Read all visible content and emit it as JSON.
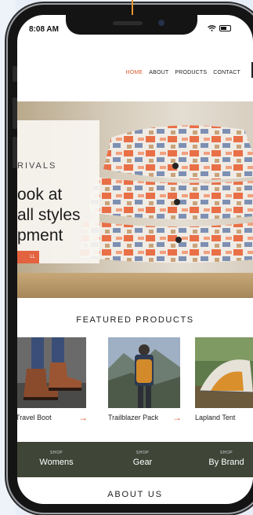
{
  "status_bar": {
    "time": "8:08 AM"
  },
  "nav": {
    "items": [
      {
        "label": "HOME"
      },
      {
        "label": "ABOUT"
      },
      {
        "label": "PRODUCTS"
      },
      {
        "label": "CONTACT"
      }
    ]
  },
  "hero": {
    "eyebrow": "RIVALS",
    "title": "ook at\nall styles\npment",
    "button_label": "LL"
  },
  "featured": {
    "title": "FEATURED PRODUCTS",
    "products": [
      {
        "name": "Travel Boot"
      },
      {
        "name": "Trailblazer Pack"
      },
      {
        "name": "Lapland Tent"
      }
    ]
  },
  "shop": {
    "items": [
      {
        "kicker": "SHOP",
        "label": "Womens"
      },
      {
        "kicker": "SHOP",
        "label": "Gear"
      },
      {
        "kicker": "SHOP",
        "label": "By Brand"
      }
    ]
  },
  "about": {
    "title": "ABOUT US"
  },
  "colors": {
    "accent": "#e0592e",
    "shop_band": "#3f4537"
  }
}
